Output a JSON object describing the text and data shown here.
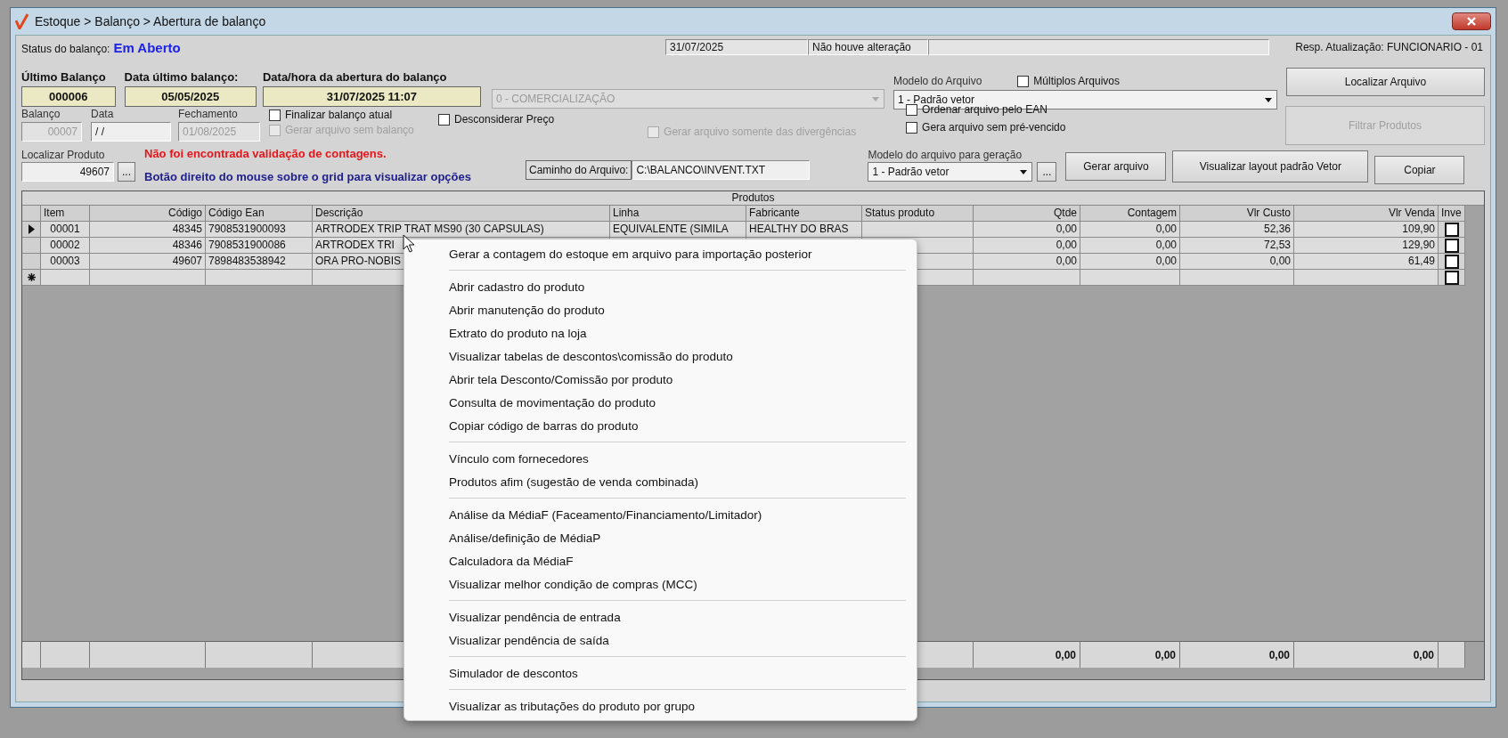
{
  "window": {
    "title": "Estoque > Balanço > Abertura de balanço"
  },
  "status": {
    "label": "Status do balanço:",
    "value": "Em Aberto",
    "date": "31/07/2025",
    "change": "Não houve alteração",
    "responsible": "Resp. Atualização: FUNCIONARIO - 01"
  },
  "summary": [
    {
      "label": "Último Balanço",
      "value": "000006"
    },
    {
      "label": "Data último balanço:",
      "value": "05/05/2025"
    },
    {
      "label": "Data/hora da abertura do balanço",
      "value": "31/07/2025 11:07"
    }
  ],
  "type_combo": {
    "value": "0 - COMERCIALIZAÇÃO",
    "disabled": true
  },
  "file_model": {
    "label": "Modelo do Arquivo",
    "value": "1 - Padrão vetor"
  },
  "multiple_files": {
    "label": "Múltiplos Arquivos",
    "checked": false,
    "disabled": false
  },
  "locate_file_button": {
    "label": "Localizar Arquivo",
    "disabled": false
  },
  "balance_fields": [
    {
      "label": "Balanço",
      "value": "00007",
      "disabled": true
    },
    {
      "label": "Data",
      "value": "/ /",
      "disabled": false
    },
    {
      "label": "Fechamento",
      "value": "01/08/2025",
      "disabled": true
    }
  ],
  "close_options": [
    {
      "label": "Finalizar balanço atual",
      "checked": false,
      "disabled": false
    },
    {
      "label": "Gerar arquivo sem balanço",
      "checked": false,
      "disabled": true
    }
  ],
  "ignore_price": {
    "label": "Desconsiderar Preço",
    "checked": false,
    "disabled": false
  },
  "divergences_only": {
    "label": "Gerar arquivo somente das divergências",
    "checked": false,
    "disabled": true
  },
  "file_options": [
    {
      "label": "Ordenar arquivo pelo EAN",
      "checked": false,
      "disabled": false
    },
    {
      "label": "Gera arquivo sem pré-vencido",
      "checked": false,
      "disabled": false
    }
  ],
  "filter_button": {
    "label": "Filtrar Produtos",
    "disabled": true
  },
  "product_search": {
    "label": "Localizar Produto",
    "value": "49607",
    "button": "..."
  },
  "messages": [
    {
      "kind": "error",
      "text": "Não foi encontrada validação de contagens."
    },
    {
      "kind": "hint",
      "text": "Botão direito do mouse sobre o grid para visualizar opções"
    }
  ],
  "file_path": {
    "label": "Caminho do Arquivo:",
    "value": "C:\\BALANCO\\INVENT.TXT"
  },
  "generation_model": {
    "label": "Modelo do arquivo para geração",
    "value": "1 - Padrão vetor",
    "button": "..."
  },
  "actions": [
    {
      "label": "Gerar arquivo",
      "disabled": false
    },
    {
      "label": "Visualizar layout padrão Vetor",
      "disabled": false
    },
    {
      "label": "Copiar",
      "disabled": false
    }
  ],
  "grid": {
    "title": "Produtos",
    "columns": [
      "Item",
      "Código",
      "Código Ean",
      "Descrição",
      "Linha",
      "Fabricante",
      "Status produto",
      "Qtde",
      "Contagem",
      "Vlr Custo",
      "Vlr Venda",
      "Inve"
    ],
    "rows": [
      {
        "kind": "data",
        "current": true,
        "cells": [
          "00001",
          "48345",
          "7908531900093",
          "ARTRODEX TRIP TRAT MS90 (30 CAPSULAS)",
          "EQUIVALENTE (SIMILA",
          "HEALTHY DO BRAS",
          null,
          "0,00",
          "0,00",
          "52,36",
          "109,90"
        ],
        "inventoried": false
      },
      {
        "kind": "data",
        "current": false,
        "cells": [
          "00002",
          "48346",
          "7908531900086",
          "ARTRODEX TRI",
          null,
          null,
          null,
          "0,00",
          "0,00",
          "72,53",
          "129,90"
        ],
        "inventoried": false
      },
      {
        "kind": "data",
        "current": false,
        "cells": [
          "00003",
          "49607",
          "7898483538942",
          "ORA PRO-NOBIS",
          null,
          null,
          null,
          "0,00",
          "0,00",
          "0,00",
          "61,49"
        ],
        "inventoried": false
      },
      {
        "kind": "new",
        "current": false,
        "cells": [],
        "inventoried": false
      }
    ],
    "totals": [
      "0,00",
      "0,00",
      "0,00",
      "0,00"
    ]
  },
  "context_menu": {
    "items": [
      {
        "kind": "item",
        "label": "Gerar a contagem do estoque em arquivo para importação posterior"
      },
      {
        "kind": "separator"
      },
      {
        "kind": "item",
        "label": "Abrir cadastro do produto"
      },
      {
        "kind": "item",
        "label": "Abrir manutenção do produto"
      },
      {
        "kind": "item",
        "label": "Extrato do produto na loja"
      },
      {
        "kind": "item",
        "label": "Visualizar tabelas de descontos\\comissão do produto"
      },
      {
        "kind": "item",
        "label": "Abrir tela Desconto/Comissão por produto"
      },
      {
        "kind": "item",
        "label": "Consulta de movimentação do produto"
      },
      {
        "kind": "item",
        "label": "Copiar código de barras do produto"
      },
      {
        "kind": "separator"
      },
      {
        "kind": "item",
        "label": "Vínculo com fornecedores"
      },
      {
        "kind": "item",
        "label": "Produtos afim (sugestão de venda combinada)"
      },
      {
        "kind": "separator"
      },
      {
        "kind": "item",
        "label": "Análise da MédiaF (Faceamento/Financiamento/Limitador)"
      },
      {
        "kind": "item",
        "label": "Análise/definição de MédiaP"
      },
      {
        "kind": "item",
        "label": "Calculadora da MédiaF"
      },
      {
        "kind": "item",
        "label": "Visualizar melhor condição de compras (MCC)"
      },
      {
        "kind": "separator"
      },
      {
        "kind": "item",
        "label": "Visualizar pendência de entrada"
      },
      {
        "kind": "item",
        "label": "Visualizar pendência de saída"
      },
      {
        "kind": "separator"
      },
      {
        "kind": "item",
        "label": "Simulador de descontos"
      },
      {
        "kind": "separator"
      },
      {
        "kind": "item",
        "label": "Visualizar as tributações do produto por grupo"
      }
    ]
  }
}
